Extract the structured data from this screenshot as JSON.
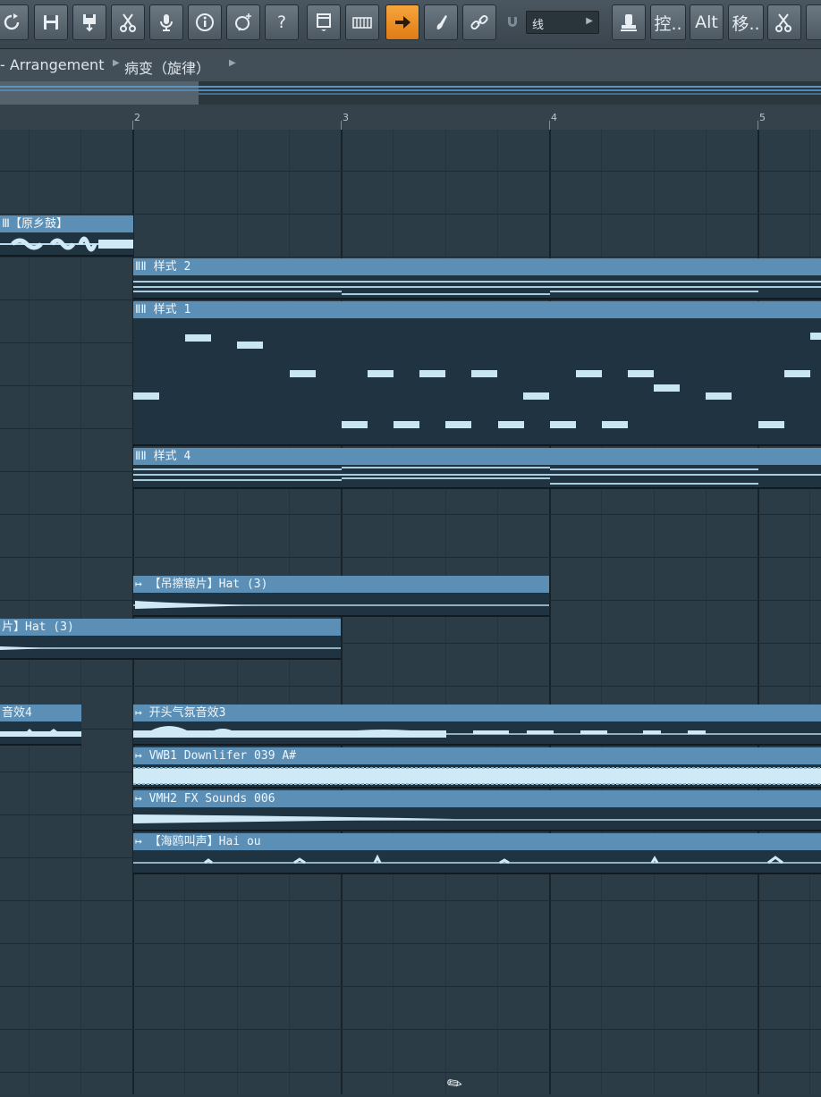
{
  "toolbar": {
    "snap_label": "线",
    "controller_label": "控..",
    "alt_label": "Alt",
    "move_label": "移..",
    "help_label": "?",
    "buttons": [
      {
        "name": "redo-icon",
        "glyph": "↻"
      },
      {
        "name": "save-icon",
        "glyph": "💾"
      },
      {
        "name": "save-as-icon",
        "glyph": "⇣"
      },
      {
        "name": "cut-icon",
        "glyph": "✂"
      },
      {
        "name": "microphone-icon",
        "glyph": "🎙"
      },
      {
        "name": "info-icon",
        "glyph": "ⓘ"
      },
      {
        "name": "wish-icon",
        "glyph": "✧"
      },
      {
        "name": "help-icon",
        "glyph": "?"
      },
      {
        "name": "window-icon",
        "glyph": "▭"
      },
      {
        "name": "piano-icon",
        "glyph": "▥"
      },
      {
        "name": "arrow-right-icon",
        "glyph": "➔"
      },
      {
        "name": "brush-icon",
        "glyph": "✍"
      },
      {
        "name": "link-icon",
        "glyph": "🔗"
      },
      {
        "name": "stamp-icon",
        "glyph": "🎩"
      },
      {
        "name": "scissors-icon",
        "glyph": "✂"
      }
    ]
  },
  "breadcrumb": {
    "first": "- Arrangement",
    "second": "病变（旋律）"
  },
  "ruler": {
    "bar_labels": [
      "2",
      "3",
      "4",
      "5"
    ]
  },
  "clips": {
    "yuanxiang": "Ⅲ【原乡鼓】",
    "pattern2": "ⅡⅡ 样式 2",
    "pattern1": "ⅡⅡ 样式 1",
    "pattern4": "ⅡⅡ 样式 4",
    "hat_main": "↦ 【吊擦镲片】Hat (3)",
    "hat_left": "片】Hat (3)",
    "fx_left": "音效4",
    "fx_open": "↦ 开头气氛音效3",
    "downlifter": "↦ VWB1 Downlifer 039 A#",
    "fx_sounds": "↦ VMH2 FX Sounds 006",
    "seagull": "↦ 【海鸥叫声】Hai ou"
  },
  "colors": {
    "clip_header": "#5c8fb5",
    "active_button": "#f08c1f",
    "grid_bg": "#2b3c47"
  }
}
